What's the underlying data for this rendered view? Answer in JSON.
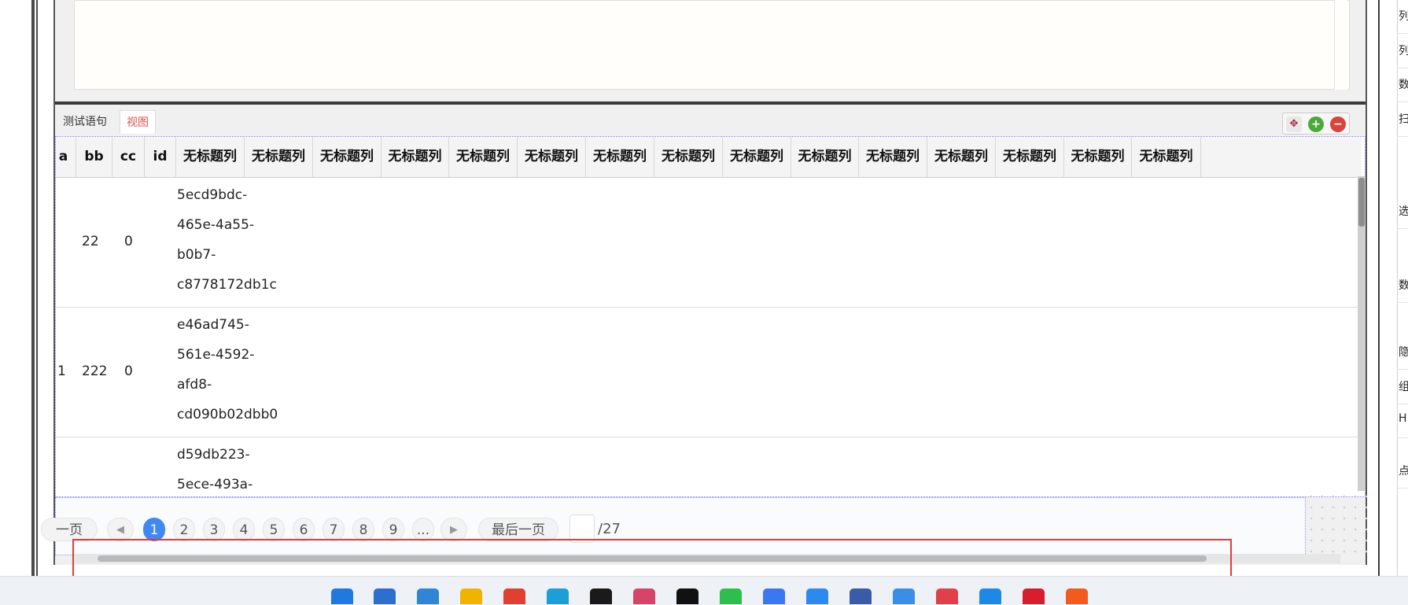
{
  "tabs": {
    "statement": "测试语句",
    "view": "视图"
  },
  "toolbar": {
    "move_icon": "move-icon",
    "add_icon": "plus-icon",
    "remove_icon": "minus-icon"
  },
  "grid": {
    "columns": [
      "a",
      "bb",
      "cc",
      "id",
      "无标题列",
      "无标题列",
      "无标题列",
      "无标题列",
      "无标题列",
      "无标题列",
      "无标题列",
      "无标题列",
      "无标题列",
      "无标题列",
      "无标题列",
      "无标题列",
      "无标题列",
      "无标题列",
      "无标题列"
    ],
    "rows": [
      {
        "a": "",
        "bb": "22",
        "cc": "0",
        "id": [
          "5ecd9bdc-",
          "465e-4a55-",
          "b0b7-",
          "c8778172db1c"
        ]
      },
      {
        "a": "1",
        "bb": "222",
        "cc": "0",
        "id": [
          "e46ad745-",
          "561e-4592-",
          "afd8-",
          "cd090b02dbb0"
        ]
      },
      {
        "a": "",
        "bb": "",
        "cc": "",
        "id": [
          "d59db223-",
          "5ece-493a-"
        ]
      }
    ]
  },
  "pager": {
    "first": "一页",
    "pages": [
      "1",
      "2",
      "3",
      "4",
      "5",
      "6",
      "7",
      "8",
      "9",
      "..."
    ],
    "current_page": "1",
    "last": "最后一页",
    "total": "/27",
    "prev_icon": "triangle-left-icon",
    "next_icon": "triangle-right-icon"
  },
  "right_panel": {
    "labels": [
      "列",
      "列",
      "数",
      "扫",
      "选",
      "数",
      "隐",
      "组",
      "H",
      "点"
    ]
  },
  "colors": {
    "accent": "#3f89f4",
    "highlight": "#e43b3b",
    "tab_active": "#d9534f"
  },
  "taskbar": {
    "icons": [
      "windows-start-icon",
      "store-icon",
      "notepad-icon",
      "folder-icon",
      "chrome-icon",
      "edge-icon",
      "webstorm-icon",
      "intellij-icon",
      "qq-icon",
      "wechat-icon",
      "feishu-icon",
      "dingtalk-icon",
      "remote-desktop-icon",
      "cloud-icon",
      "eraser-icon",
      "send-icon",
      "netease-music-icon",
      "video-icon"
    ]
  }
}
